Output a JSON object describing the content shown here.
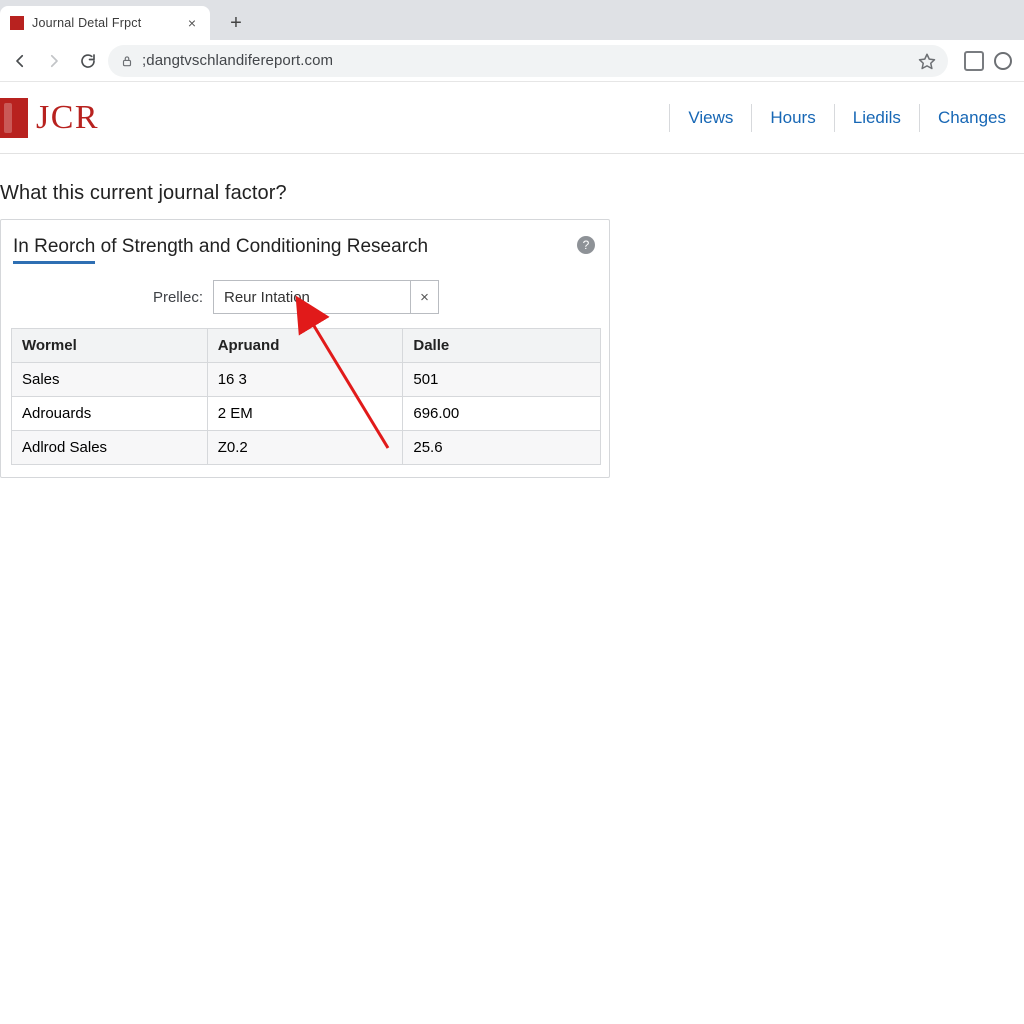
{
  "browser": {
    "tab_title": "Journal Detal Frpct",
    "url": ";dangtvschlandifereport.com"
  },
  "brand": {
    "text": "JCR"
  },
  "topnav": {
    "items": [
      "Views",
      "Hours",
      "Liedils",
      "Changes"
    ]
  },
  "question": "What this current journal factor?",
  "card_title_underlined": "In Reorch",
  "card_title_rest": " of Strength and Conditioning Research",
  "field": {
    "label": "Prellec:",
    "value": "Reur Intation"
  },
  "table": {
    "headers": [
      "Wormel",
      "Apruand",
      "Dalle"
    ],
    "rows": [
      {
        "c1": "Sales",
        "c2": "16 3",
        "c3": "501"
      },
      {
        "c1": "Adrouards",
        "c2": "2 EM",
        "c3": "696.00"
      },
      {
        "c1": "Adlrod Sales",
        "c2": "Z0.2",
        "c3": "25.6"
      }
    ]
  },
  "icons": {
    "close": "×",
    "plus": "+",
    "help": "?"
  }
}
